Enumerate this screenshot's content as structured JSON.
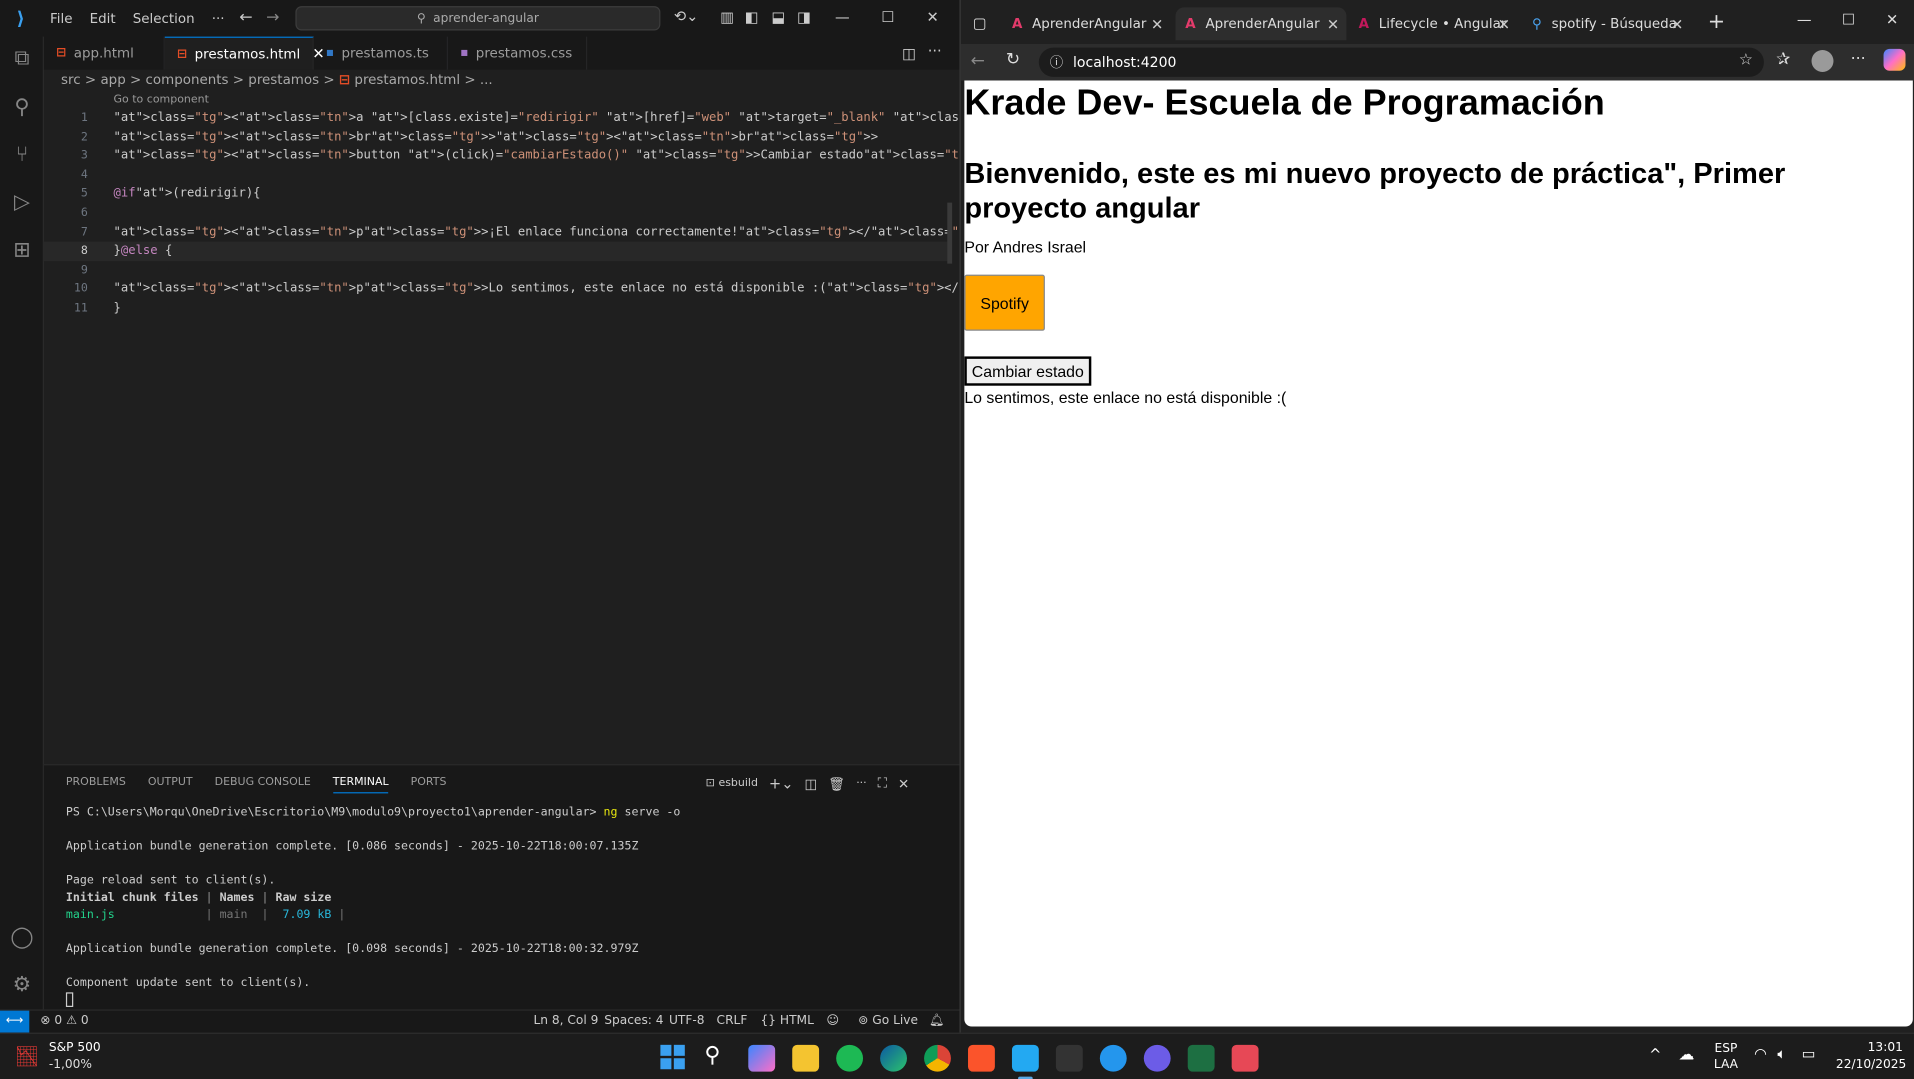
{
  "vscode": {
    "menu": [
      "File",
      "Edit",
      "Selection"
    ],
    "more_menu": "···",
    "search": "aprender-angular",
    "tabs": [
      {
        "label": "app.html",
        "icon": "html-file-icon"
      },
      {
        "label": "prestamos.html",
        "icon": "html-file-icon",
        "active": true
      },
      {
        "label": "prestamos.ts",
        "icon": "ts-file-icon"
      },
      {
        "label": "prestamos.css",
        "icon": "css-file-icon"
      }
    ],
    "breadcrumb": [
      "src",
      "app",
      "components",
      "prestamos",
      "prestamos.html",
      "..."
    ],
    "codelens": "Go to component",
    "code_lines": [
      "<a [class.existe]=\"redirigir\" [href]=\"web\" target=\"_blank\" class=\"btn btn-primary\">Spotify</a>",
      "<br><br>",
      "<button (click)=\"cambiarEstado()\" >Cambiar estado</button>",
      "",
      "@if(redirigir){",
      "",
      "<p>¡El enlace funciona correctamente!</p>",
      "}@else {",
      "",
      "<p>Lo sentimos, este enlace no está disponible :(</p>",
      "}"
    ],
    "panel_tabs": [
      "PROBLEMS",
      "OUTPUT",
      "DEBUG CONSOLE",
      "TERMINAL",
      "PORTS"
    ],
    "terminal_name": "esbuild",
    "terminal": {
      "prompt": "PS C:\\Users\\Morqu\\OneDrive\\Escritorio\\M9\\modulo9\\proyecto1\\aprender-angular>",
      "command": "ng",
      "command_args": "serve -o",
      "line1": "Application bundle generation complete. [0.086 seconds] - 2025-10-22T18:00:07.135Z",
      "line2": "Page reload sent to client(s).",
      "table_header": [
        "Initial chunk files",
        "Names",
        "Raw size"
      ],
      "table_row": [
        "main.js",
        "main",
        "7.09 kB"
      ],
      "line3": "Application bundle generation complete. [0.098 seconds] - 2025-10-22T18:00:32.979Z",
      "line4": "Component update sent to client(s)."
    },
    "status": {
      "errors": "0",
      "warnings": "0",
      "position": "Ln 8, Col 9",
      "spaces": "Spaces: 4",
      "encoding": "UTF-8",
      "eol": "CRLF",
      "language": "HTML",
      "golive": "Go Live"
    },
    "accent": "#0078d4"
  },
  "browser": {
    "tabs": [
      {
        "label": "AprenderAngular"
      },
      {
        "label": "AprenderAngular",
        "active": true
      },
      {
        "label": "Lifecycle • Angular"
      },
      {
        "label": "spotify - Búsqueda"
      }
    ],
    "url": "localhost:4200",
    "page": {
      "h1": "Krade Dev- Escuela de Programación",
      "h2": "Bienvenido, este es mi nuevo proyecto de práctica\", Primer proyecto angular",
      "byline": "Por Andres Israel",
      "spotify_button": "Spotify",
      "toggle_button": "Cambiar estado",
      "message": "Lo sentimos, este enlace no está disponible :("
    },
    "spotify_color": "#ffa500"
  },
  "taskbar": {
    "stock_name": "S&P 500",
    "stock_change": "-1,00%",
    "lang1": "ESP",
    "lang2": "LAA",
    "time": "13:01",
    "date": "22/10/2025"
  }
}
